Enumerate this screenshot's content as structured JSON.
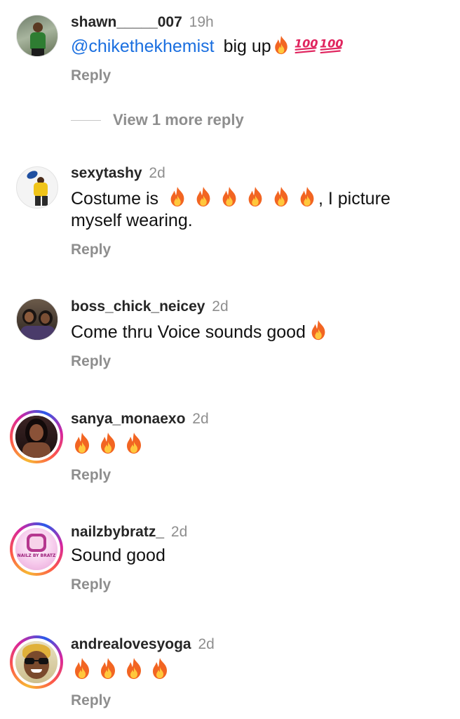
{
  "comments": [
    {
      "username": "shawn_____007",
      "time": "19h",
      "mention": "@chikethekhemist",
      "text": "big up",
      "emojis": [
        "fire",
        "hundred",
        "hundred"
      ],
      "reply_label": "Reply"
    },
    {
      "username": "sexytashy",
      "time": "2d",
      "text_before": "Costume is",
      "emojis": [
        "fire",
        "fire",
        "fire",
        "fire",
        "fire",
        "fire"
      ],
      "text_after": ", I picture",
      "text_line2": "myself wearing.",
      "reply_label": "Reply"
    },
    {
      "username": "boss_chick_neicey",
      "time": "2d",
      "text": "Come thru Voice sounds good",
      "emojis": [
        "fire"
      ],
      "reply_label": "Reply"
    },
    {
      "username": "sanya_monaexo",
      "time": "2d",
      "emojis": [
        "fire",
        "fire",
        "fire"
      ],
      "reply_label": "Reply"
    },
    {
      "username": "nailzbybratz_",
      "time": "2d",
      "text": "Sound good",
      "avatar_text": "NAILZ BY BRATZ",
      "reply_label": "Reply"
    },
    {
      "username": "andrealovesyoga",
      "time": "2d",
      "emojis": [
        "fire",
        "fire",
        "fire",
        "fire"
      ],
      "reply_label": "Reply"
    }
  ],
  "view_more": "View 1 more reply",
  "colors": {
    "mention": "#1a6fe0",
    "muted": "#8e8e8e",
    "fire_outer": "#f26522",
    "fire_inner": "#ffc83d",
    "hundred": "#e0245e"
  }
}
